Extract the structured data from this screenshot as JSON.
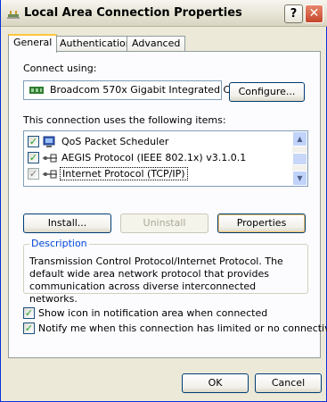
{
  "window": {
    "title": "Local Area Connection Properties",
    "help": "?",
    "close": "✕"
  },
  "tabs": [
    {
      "label": "General",
      "active": true
    },
    {
      "label": "Authentication",
      "active": false
    },
    {
      "label": "Advanced",
      "active": false
    }
  ],
  "general": {
    "connect_using_label": "Connect using:",
    "adapter_name": "Broadcom 570x Gigabit Integrated Co",
    "configure_label": "Configure...",
    "items_label": "This connection uses the following items:",
    "items": [
      {
        "label": "QoS Packet Scheduler",
        "checked": true,
        "icon": "scheduler-icon"
      },
      {
        "label": "AEGIS Protocol (IEEE 802.1x) v3.1.0.1",
        "checked": true,
        "icon": "protocol-icon"
      },
      {
        "label": "Internet Protocol (TCP/IP)",
        "checked": true,
        "icon": "protocol-icon",
        "selected": true
      }
    ],
    "install_label": "Install...",
    "uninstall_label": "Uninstall",
    "properties_label": "Properties",
    "description_title": "Description",
    "description_text": "Transmission Control Protocol/Internet Protocol. The default wide area network protocol that provides communication across diverse interconnected networks.",
    "show_icon_label": "Show icon in notification area when connected",
    "show_icon_checked": true,
    "notify_label": "Notify me when this connection has limited or no connectivity",
    "notify_checked": true
  },
  "footer": {
    "ok_label": "OK",
    "cancel_label": "Cancel"
  }
}
